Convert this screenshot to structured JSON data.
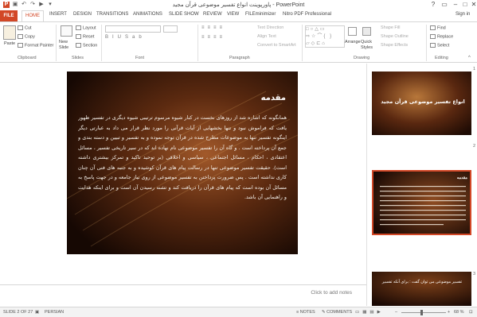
{
  "title": "پاورپوینت انواع تفسیر موضوعی قرآن مجید - PowerPoint",
  "user": "Sign in",
  "tabs": {
    "file": "FILE",
    "home": "HOME",
    "items": [
      "INSERT",
      "DESIGN",
      "TRANSITIONS",
      "ANIMATIONS",
      "SLIDE SHOW",
      "REVIEW",
      "VIEW",
      "FILEminimizer",
      "Nitro PDF Professional"
    ]
  },
  "ribbon": {
    "clipboard": {
      "label": "Clipboard",
      "paste": "Paste",
      "cut": "Cut",
      "copy": "Copy",
      "format_painter": "Format Painter"
    },
    "slides": {
      "label": "Slides",
      "new_slide": "New Slide",
      "layout": "Layout",
      "reset": "Reset",
      "section": "Section"
    },
    "font": {
      "label": "Font"
    },
    "paragraph": {
      "label": "Paragraph",
      "text_direction": "Text Direction",
      "align_text": "Align Text",
      "convert": "Convert to SmartArt"
    },
    "drawing": {
      "label": "Drawing",
      "arrange": "Arrange",
      "quick_styles": "Quick Styles",
      "shape_fill": "Shape Fill",
      "shape_outline": "Shape Outline",
      "shape_effects": "Shape Effects"
    },
    "editing": {
      "label": "Editing",
      "find": "Find",
      "replace": "Replace",
      "select": "Select"
    }
  },
  "slide": {
    "heading": "مقدمه",
    "body": "همانگونه که اشاره شد از روزهای نخست در کنار شیوه مرسوم ترتیبی شیوه دیگری در تفسیر ظهور یافت که فراموش نبود و تنها بخشهایی از آیات قرآنی را مورد نظر قرار می داد به عبارتی دیگر اینگونه تفسیر تنها به موضوعات مطرح شده در قرآن توجه نموده و به تفسیر و تبیین و دسته بندی و جمع آن پرداخته است . و گاه آن را تفسیر موضوعی نام نهاده اند که در سیر تاریخی تفسیر ، مسائل اعتقادی ، احکام ، مسائل اجتماعی ، سیاسی و اخلاقی (بر توحید تاکید و تمرکز بیشتری داشته است). حقیقت تفسیر موضوعی تنها در رسالت پیام های قرآن کوشیده و به جنبه های فنی آن چنان کاری نداشته است . پس ضرورت پرداختن به تفسیر موضوعی از روی نیاز جامعه و در جهت پاسخ به مسائل آن بوده است که پیام های قرآن را دریافت کند و تشنه رسیدن آن است و برای اینکه هدایت و راهنمایی آن باشد."
  },
  "notes_placeholder": "Click to add notes",
  "thumbnails": [
    {
      "num": "1",
      "title": "انواع تفسیر موضوعی قرآن مجید"
    },
    {
      "num": "2",
      "title": "مقدمه"
    },
    {
      "num": "3",
      "title": "تفسیر موضوعی می توان گفت : برای آنکه تفسیر"
    }
  ],
  "status": {
    "slide_of": "SLIDE 2 OF 27",
    "language": "PERSIAN",
    "notes": "NOTES",
    "comments": "COMMENTS",
    "zoom": "68 %"
  },
  "colors": {
    "accent": "#d24726",
    "file_tab": "#d24726"
  }
}
